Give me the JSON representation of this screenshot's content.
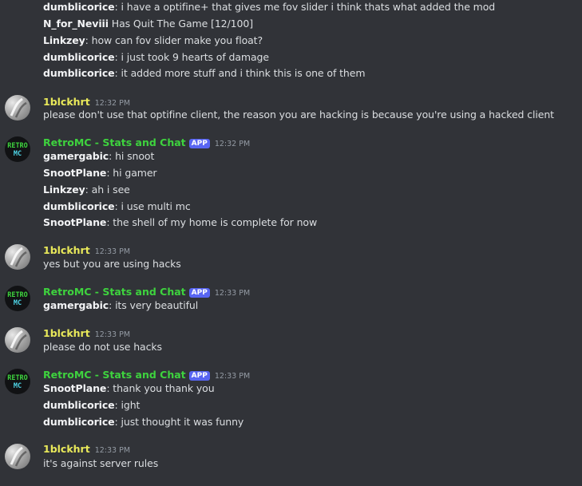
{
  "colors": {
    "background": "#313338",
    "author_1blckhrt": "#e9e95a",
    "author_retromc": "#3ed33e",
    "app_badge": "#5865f2",
    "timestamp": "#949ba4"
  },
  "messages": [
    {
      "kind": "continuation",
      "lines": [
        {
          "user": "dumblicorice",
          "text": ": i have a optifine+ that gives me fov slider i think thats what added the mod"
        },
        {
          "user": "N_for_Neviii",
          "text": " Has Quit The Game [12/100]"
        },
        {
          "user": "Linkzey",
          "text": ": how can fov slider make you float?"
        },
        {
          "user": "dumblicorice",
          "text": ": i just took 9 hearts of damage"
        },
        {
          "user": "dumblicorice",
          "text": ": it added more stuff and i think this is one of them"
        }
      ]
    },
    {
      "kind": "message",
      "author": "1blckhrt",
      "avatar_icon": "silver-swirl-avatar",
      "time": "12:32 PM",
      "lines": [
        {
          "user": "",
          "text": "please don't use that optifine client, the reason you are hacking is because you're using a hacked client"
        }
      ]
    },
    {
      "kind": "message",
      "author": "RetroMC - Stats and Chat",
      "badge": "APP",
      "avatar_icon": "retro-mc-logo",
      "avatar_text_top": "RETRO",
      "avatar_text_bottom": "MC",
      "time": "12:32 PM",
      "lines": [
        {
          "user": "gamergabic",
          "text": ": hi snoot"
        },
        {
          "user": "SnootPlane",
          "text": ": hi gamer"
        },
        {
          "user": "Linkzey",
          "text": ": ah i see"
        },
        {
          "user": "dumblicorice",
          "text": ": i use multi mc"
        },
        {
          "user": "SnootPlane",
          "text": ": the shell of my home is complete for now"
        }
      ]
    },
    {
      "kind": "message",
      "author": "1blckhrt",
      "avatar_icon": "silver-swirl-avatar",
      "time": "12:33 PM",
      "lines": [
        {
          "user": "",
          "text": "yes but you are using hacks"
        }
      ]
    },
    {
      "kind": "message",
      "author": "RetroMC - Stats and Chat",
      "badge": "APP",
      "avatar_icon": "retro-mc-logo",
      "avatar_text_top": "RETRO",
      "avatar_text_bottom": "MC",
      "time": "12:33 PM",
      "lines": [
        {
          "user": "gamergabic",
          "text": ": its very beautiful"
        }
      ]
    },
    {
      "kind": "message",
      "author": "1blckhrt",
      "avatar_icon": "silver-swirl-avatar",
      "time": "12:33 PM",
      "lines": [
        {
          "user": "",
          "text": "please do not use hacks"
        }
      ]
    },
    {
      "kind": "message",
      "author": "RetroMC - Stats and Chat",
      "badge": "APP",
      "avatar_icon": "retro-mc-logo",
      "avatar_text_top": "RETRO",
      "avatar_text_bottom": "MC",
      "time": "12:33 PM",
      "lines": [
        {
          "user": "SnootPlane",
          "text": ": thank you thank you"
        },
        {
          "user": "dumblicorice",
          "text": ": ight"
        },
        {
          "user": "dumblicorice",
          "text": ": just thought it was funny"
        }
      ]
    },
    {
      "kind": "message",
      "author": "1blckhrt",
      "avatar_icon": "silver-swirl-avatar",
      "time": "12:33 PM",
      "lines": [
        {
          "user": "",
          "text": "it's against server rules"
        }
      ]
    }
  ]
}
